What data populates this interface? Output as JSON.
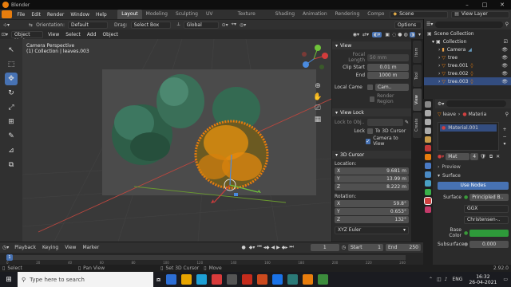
{
  "title": {
    "app": "Blender"
  },
  "menubar": {
    "items": [
      "File",
      "Edit",
      "Render",
      "Window",
      "Help"
    ],
    "workspaces": [
      "Layout",
      "Modeling",
      "Sculpting",
      "UV Editing",
      "Texture Paint",
      "Shading",
      "Animation",
      "Rendering",
      "Compo"
    ],
    "scene_label": "Scene",
    "view_layer_label": "View Layer"
  },
  "header2": {
    "orientation_label": "Orientation:",
    "orientation_value": "Default",
    "drag_label": "Drag:",
    "drag_value": "Select Box",
    "transform_value": "Global",
    "options_label": "Options"
  },
  "header3": {
    "mode": "Object Mode",
    "items": [
      "View",
      "Select",
      "Add",
      "Object"
    ]
  },
  "viewport": {
    "camera_line1": "Camera Perspective",
    "camera_line2": "(1) Collection | leaves.003",
    "gizmo": {
      "x": "X",
      "y": "Y",
      "z": "Z"
    }
  },
  "npanel": {
    "view_title": "View",
    "focal_label": "Focal Length",
    "focal_value": "50 mm",
    "clip_start_label": "Clip Start",
    "clip_start_value": "0.01 m",
    "clip_end_label": "End",
    "clip_end_value": "1000 m",
    "local_camera_label": "Local Came",
    "local_camera_value": "Cam..",
    "render_region_label": "Render Region",
    "view_lock_title": "View Lock",
    "lock_to_obj_label": "Lock to Obj..",
    "lock_label": "Lock",
    "to_3d_cursor": "To 3D Cursor",
    "camera_to_view": "Camera to View",
    "cursor_title": "3D Cursor",
    "location_label": "Location:",
    "loc_x": "9.681 m",
    "loc_y": "13.99 m",
    "loc_z": "8.222 m",
    "rotation_label": "Rotation:",
    "rot_x": "59.8°",
    "rot_y": "0.653°",
    "rot_z": "132°",
    "rot_mode": "XYZ Euler",
    "axes": [
      "X",
      "Y",
      "Z"
    ],
    "tabs": [
      "Item",
      "Tool",
      "View",
      "Create"
    ]
  },
  "outliner": {
    "scene_collection": "Scene Collection",
    "collection": "Collection",
    "items": [
      "Camera",
      "tree",
      "tree.001",
      "tree.002",
      "tree.003"
    ]
  },
  "props": {
    "object_name": "leave",
    "material_label": "Materia",
    "slot": "Material.001",
    "mat_name": "Mat",
    "mat_users": "4",
    "preview_label": "Preview",
    "surface_section": "Surface",
    "use_nodes": "Use Nodes",
    "surface_label": "Surface",
    "surface_value": "Principled B..",
    "distribution": "GGX",
    "subsurface_method": "Christensen-..",
    "base_color_label": "Base Color",
    "base_color": "#2e9a3a",
    "subsurface_label": "Subsurface",
    "subsurface_value": "0.000"
  },
  "timeline": {
    "items": [
      "Playback",
      "Keying",
      "View",
      "Marker"
    ],
    "current_frame": "1",
    "start_label": "Start",
    "start_value": "1",
    "end_label": "End",
    "end_value": "250",
    "ticks": [
      "0",
      "20",
      "40",
      "60",
      "80",
      "100",
      "120",
      "140",
      "160",
      "180",
      "200",
      "220",
      "240"
    ]
  },
  "statusbar": {
    "select": "Select",
    "pan_view": "Pan View",
    "set_3d_cursor": "Set 3D Cursor",
    "move": "Move",
    "version": "2.92.0"
  },
  "taskbar": {
    "search_placeholder": "Type here to search",
    "time": "16:32",
    "date": "26-04-2021",
    "lang": "ENG"
  },
  "colors": {
    "accent": "#4772b3",
    "selection_orange": "#e87d0d",
    "tree_green": "#2f6b4a"
  }
}
